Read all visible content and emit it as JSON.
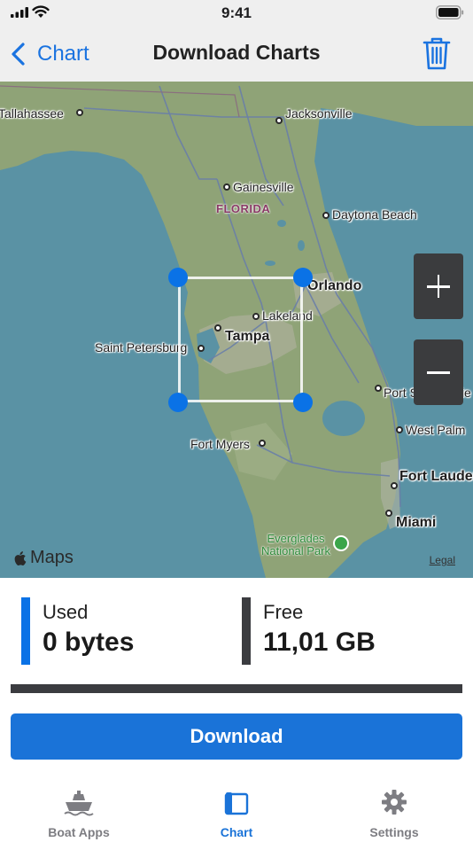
{
  "status_bar": {
    "time": "9:41"
  },
  "nav": {
    "back_label": "Chart",
    "title": "Download Charts"
  },
  "map": {
    "cities": {
      "tallahassee": "Tallahassee",
      "jacksonville": "Jacksonville",
      "gainesville": "Gainesville",
      "daytona_beach": "Daytona Beach",
      "orlando": "Orlando",
      "lakeland": "Lakeland",
      "tampa": "Tampa",
      "saint_petersburg": "Saint Petersburg",
      "port_saint_lucie": "Port Saint Lucie",
      "west_palm": "West Palm",
      "fort_myers": "Fort Myers",
      "fort_lauderdale": "Fort Lauderdale",
      "miami": "Miami"
    },
    "state_label": "FLORIDA",
    "park_label_line1": "Everglades",
    "park_label_line2": "National Park",
    "maps_logo": "Maps",
    "legal": "Legal"
  },
  "storage": {
    "used_label": "Used",
    "used_value": "0 bytes",
    "used_color": "#0a72e6",
    "free_label": "Free",
    "free_value": "11,01 GB",
    "free_color": "#3b3c40",
    "used_fraction": 0
  },
  "download_label": "Download",
  "tabs": [
    {
      "label": "Boat Apps",
      "icon": "boat-icon",
      "active": false
    },
    {
      "label": "Chart",
      "icon": "chart-book-icon",
      "active": true
    },
    {
      "label": "Settings",
      "icon": "gear-icon",
      "active": false
    }
  ],
  "colors": {
    "accent": "#1a73d8",
    "inactive_tab": "#7d7d82",
    "nav_bg": "#efefef"
  }
}
